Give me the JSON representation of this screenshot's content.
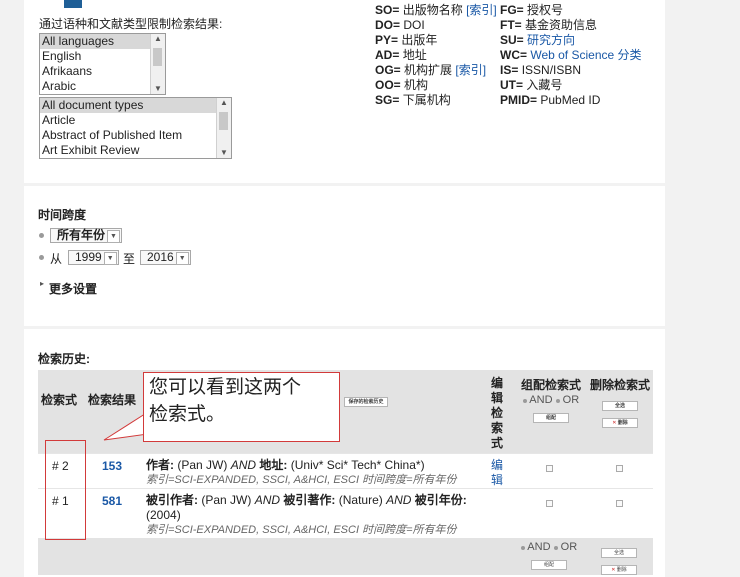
{
  "filters": {
    "label": "通过语种和文献类型限制检索结果:",
    "languages": [
      "All languages",
      "English",
      "Afrikaans",
      "Arabic"
    ],
    "doc_types": [
      "All document types",
      "Article",
      "Abstract of Published Item",
      "Art Exhibit Review"
    ]
  },
  "field_tags": {
    "col1": [
      {
        "code": "SO=",
        "name": "出版物名称",
        "link": "[索引]"
      },
      {
        "code": "DO=",
        "name": "DOI",
        "link": ""
      },
      {
        "code": "PY=",
        "name": "出版年",
        "link": ""
      },
      {
        "code": "AD=",
        "name": "地址",
        "link": ""
      },
      {
        "code": "OG=",
        "name": "机构扩展",
        "link": "[索引]"
      },
      {
        "code": "OO=",
        "name": "机构",
        "link": ""
      },
      {
        "code": "SG=",
        "name": "下属机构",
        "link": ""
      }
    ],
    "col2": [
      {
        "code": "FG=",
        "name": "授权号",
        "link": ""
      },
      {
        "code": "FT=",
        "name": "基金资助信息",
        "link": ""
      },
      {
        "code": "SU=",
        "name": "",
        "link": "研究方向"
      },
      {
        "code": "WC=",
        "name": "",
        "link": "Web of Science 分类"
      },
      {
        "code": "IS=",
        "name": "ISSN/ISBN",
        "link": ""
      },
      {
        "code": "UT=",
        "name": "入藏号",
        "link": ""
      },
      {
        "code": "PMID=",
        "name": "PubMed ID",
        "link": ""
      }
    ]
  },
  "timespan": {
    "title": "时间跨度",
    "all_years": "所有年份",
    "from_label": "从",
    "from_year": "1999",
    "to_label": "至",
    "to_year": "2016",
    "more_settings": "更多设置"
  },
  "history": {
    "title": "检索历史:",
    "headers": {
      "query_no": "检索式",
      "results": "检索结果",
      "saved_history": "保存的检索历史",
      "edit": "编辑检索式",
      "combine": "组配检索式",
      "delete": "删除检索式"
    },
    "and_label": "AND",
    "or_label": "OR",
    "combine_btn": "组配",
    "select_all_btn": "全选",
    "delete_btn": "删除",
    "edit_link": "编辑",
    "rows": [
      {
        "no": "# 2",
        "count": "153",
        "f1": "作者:",
        "v1": "(Pan JW)",
        "op1": "AND",
        "f2": "地址:",
        "v2": "(Univ* Sci* Tech* China*)",
        "op2": "",
        "f3": "",
        "v3": "",
        "v4": "",
        "index": "索引=SCI-EXPANDED, SSCI, A&HCI, ESCI 时间跨度=所有年份"
      },
      {
        "no": "# 1",
        "count": "581",
        "f1": "被引作者:",
        "v1": "(Pan JW)",
        "op1": "AND",
        "f2": "被引著作:",
        "v2": "(Nature)",
        "op2": "AND",
        "f3": "被引年份:",
        "v3": "",
        "v4": "(2004)",
        "index": "索引=SCI-EXPANDED, SSCI, A&HCI, ESCI 时间跨度=所有年份"
      }
    ]
  },
  "callout": {
    "line1": "您可以看到这两个",
    "line2": "检索式。"
  }
}
